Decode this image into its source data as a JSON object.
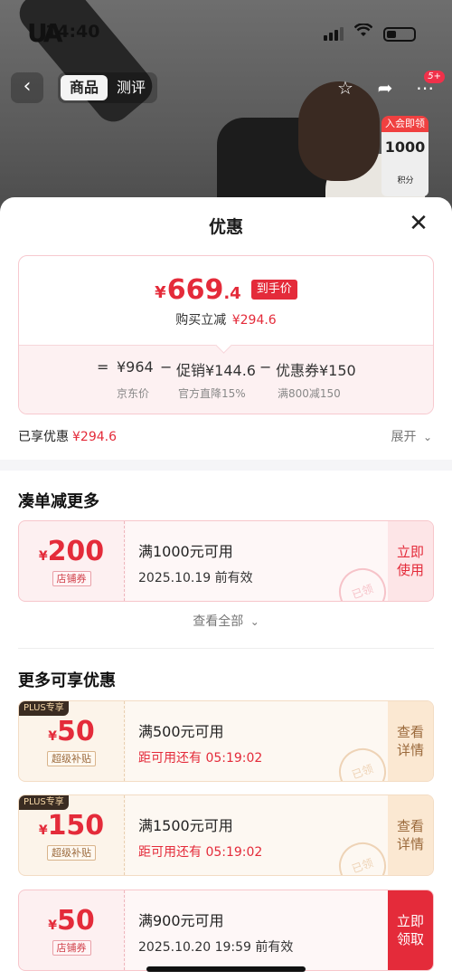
{
  "status_bar": {
    "time": "14:40",
    "brand_logo": "UA"
  },
  "nav": {
    "back_icon": "chevron-left-icon",
    "tabs": [
      {
        "label": "商品",
        "active": true
      },
      {
        "label": "测评",
        "active": false
      }
    ],
    "badge_count": "5+"
  },
  "member": {
    "label": "入会即领",
    "points": "1000",
    "unit": "积分"
  },
  "sheet": {
    "title": "优惠",
    "final_price": {
      "currency": "¥",
      "integer": "669",
      "decimal": ".4",
      "tag": "到手价"
    },
    "instant_discount": {
      "label": "购买立减",
      "amount": "¥294.6"
    },
    "formula": {
      "equals": "=",
      "jd_price": "¥964",
      "minus1": "−",
      "promo": "促销¥144.6",
      "minus2": "−",
      "coupon": "优惠券¥150",
      "jd_price_label": "京东价",
      "promo_label": "官方直降15%",
      "coupon_label": "满800减150"
    },
    "enjoyed": {
      "label": "已享优惠",
      "amount": "¥294.6"
    },
    "expand_label": "展开"
  },
  "section1": {
    "title": "凑单减更多",
    "coupon": {
      "currency": "¥",
      "amount": "200",
      "tag": "店铺券",
      "condition": "满1000元可用",
      "validity": "2025.10.19 前有效",
      "button": "立即使用",
      "stamp": "已领"
    },
    "see_all": "查看全部"
  },
  "section2": {
    "title": "更多可享优惠",
    "coupons": [
      {
        "plus": "PLUS专享",
        "currency": "¥",
        "amount": "50",
        "tag": "超级补贴",
        "condition": "满500元可用",
        "validity": "距可用还有 05:19:02",
        "button": "查看详情",
        "stamp": "已领"
      },
      {
        "plus": "PLUS专享",
        "currency": "¥",
        "amount": "150",
        "tag": "超级补贴",
        "condition": "满1500元可用",
        "validity": "距可用还有 05:19:02",
        "button": "查看详情",
        "stamp": "已领"
      },
      {
        "currency": "¥",
        "amount": "50",
        "tag": "店铺券",
        "condition": "满900元可用",
        "validity": "2025.10.20 19:59 前有效",
        "button": "立即领取"
      }
    ]
  },
  "colors": {
    "accent_red": "#e42b3a",
    "plus_gold": "#9b6a3c"
  }
}
